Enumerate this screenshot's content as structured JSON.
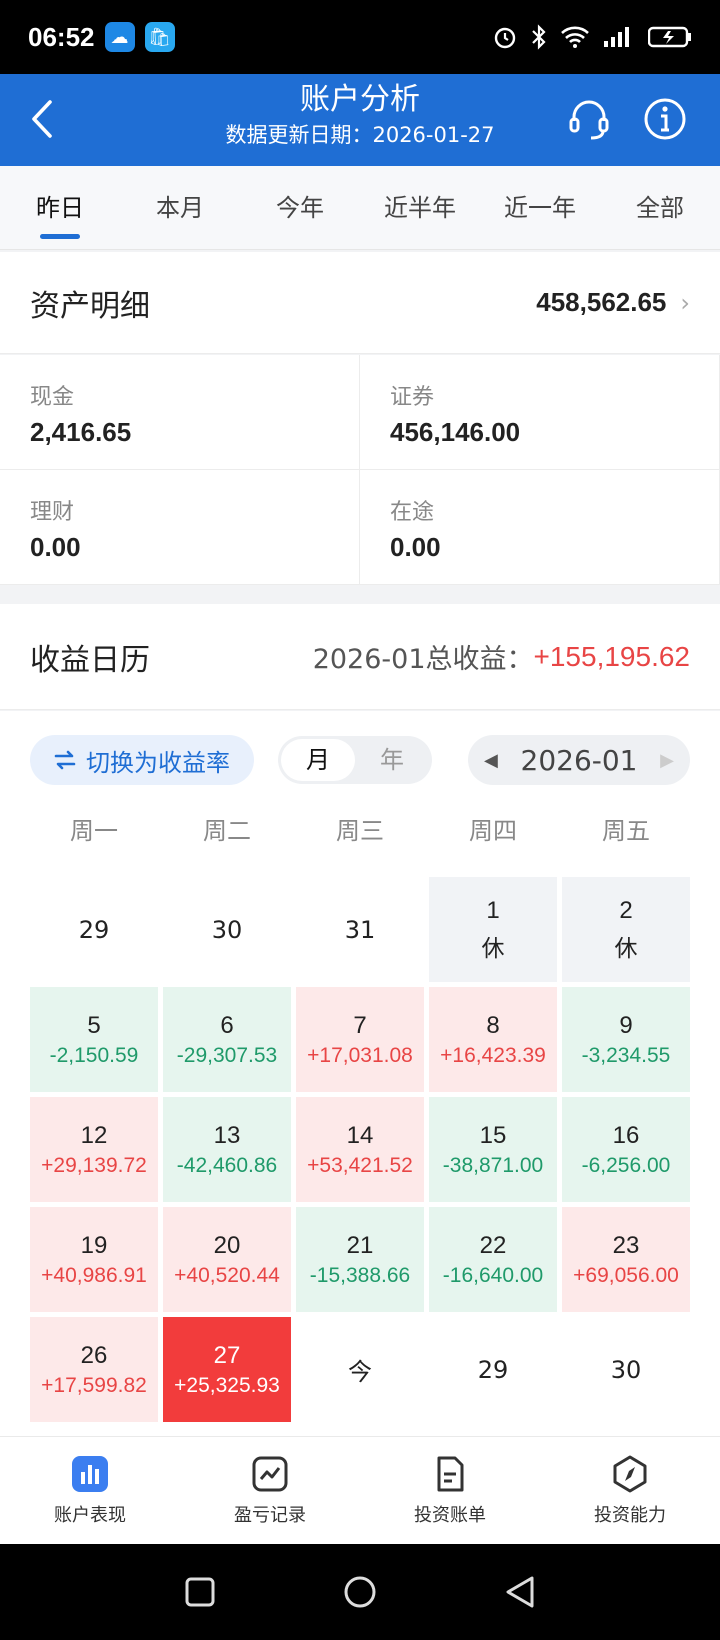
{
  "status_bar": {
    "time": "06:52"
  },
  "header": {
    "title": "账户分析",
    "subtitle": "数据更新日期：2026-01-27"
  },
  "tabs": [
    "昨日",
    "本月",
    "今年",
    "近半年",
    "近一年",
    "全部"
  ],
  "assets": {
    "label": "资产明细",
    "total": "458,562.65",
    "items": [
      {
        "key": "现金",
        "value": "2,416.65"
      },
      {
        "key": "证券",
        "value": "456,146.00"
      },
      {
        "key": "理财",
        "value": "0.00"
      },
      {
        "key": "在途",
        "value": "0.00"
      }
    ]
  },
  "calendar": {
    "label": "收益日历",
    "summary_label": "2026-01总收益：",
    "summary_value": "+155,195.62",
    "switch_label": "切换为收益率",
    "seg_month": "月",
    "seg_year": "年",
    "month": "2026-01",
    "weekdays": [
      "周一",
      "周二",
      "周三",
      "周四",
      "周五"
    ],
    "days": [
      {
        "n": "29",
        "s": "",
        "type": "plain"
      },
      {
        "n": "30",
        "s": "",
        "type": "plain"
      },
      {
        "n": "31",
        "s": "",
        "type": "plain"
      },
      {
        "n": "1",
        "s": "休",
        "type": "holiday"
      },
      {
        "n": "2",
        "s": "休",
        "type": "holiday"
      },
      {
        "n": "5",
        "s": "-2,150.59",
        "type": "loss"
      },
      {
        "n": "6",
        "s": "-29,307.53",
        "type": "loss"
      },
      {
        "n": "7",
        "s": "+17,031.08",
        "type": "gain"
      },
      {
        "n": "8",
        "s": "+16,423.39",
        "type": "gain"
      },
      {
        "n": "9",
        "s": "-3,234.55",
        "type": "loss"
      },
      {
        "n": "12",
        "s": "+29,139.72",
        "type": "gain"
      },
      {
        "n": "13",
        "s": "-42,460.86",
        "type": "loss"
      },
      {
        "n": "14",
        "s": "+53,421.52",
        "type": "gain"
      },
      {
        "n": "15",
        "s": "-38,871.00",
        "type": "loss"
      },
      {
        "n": "16",
        "s": "-6,256.00",
        "type": "loss"
      },
      {
        "n": "19",
        "s": "+40,986.91",
        "type": "gain"
      },
      {
        "n": "20",
        "s": "+40,520.44",
        "type": "gain"
      },
      {
        "n": "21",
        "s": "-15,388.66",
        "type": "loss"
      },
      {
        "n": "22",
        "s": "-16,640.00",
        "type": "loss"
      },
      {
        "n": "23",
        "s": "+69,056.00",
        "type": "gain"
      },
      {
        "n": "26",
        "s": "+17,599.82",
        "type": "gain"
      },
      {
        "n": "27",
        "s": "+25,325.93",
        "type": "today"
      },
      {
        "n": "今",
        "s": "",
        "type": "plain"
      },
      {
        "n": "29",
        "s": "",
        "type": "plain"
      },
      {
        "n": "30",
        "s": "",
        "type": "plain"
      }
    ]
  },
  "bottom_nav": [
    {
      "label": "账户表现",
      "icon": "bar-chart-icon",
      "active": true
    },
    {
      "label": "盈亏记录",
      "icon": "trend-chart-icon",
      "active": false
    },
    {
      "label": "投资账单",
      "icon": "document-icon",
      "active": false
    },
    {
      "label": "投资能力",
      "icon": "compass-icon",
      "active": false
    }
  ],
  "colors": {
    "brand": "#1f6ed4",
    "gain": "#e84545",
    "loss": "#1f9a6a",
    "today": "#f23c3c"
  }
}
